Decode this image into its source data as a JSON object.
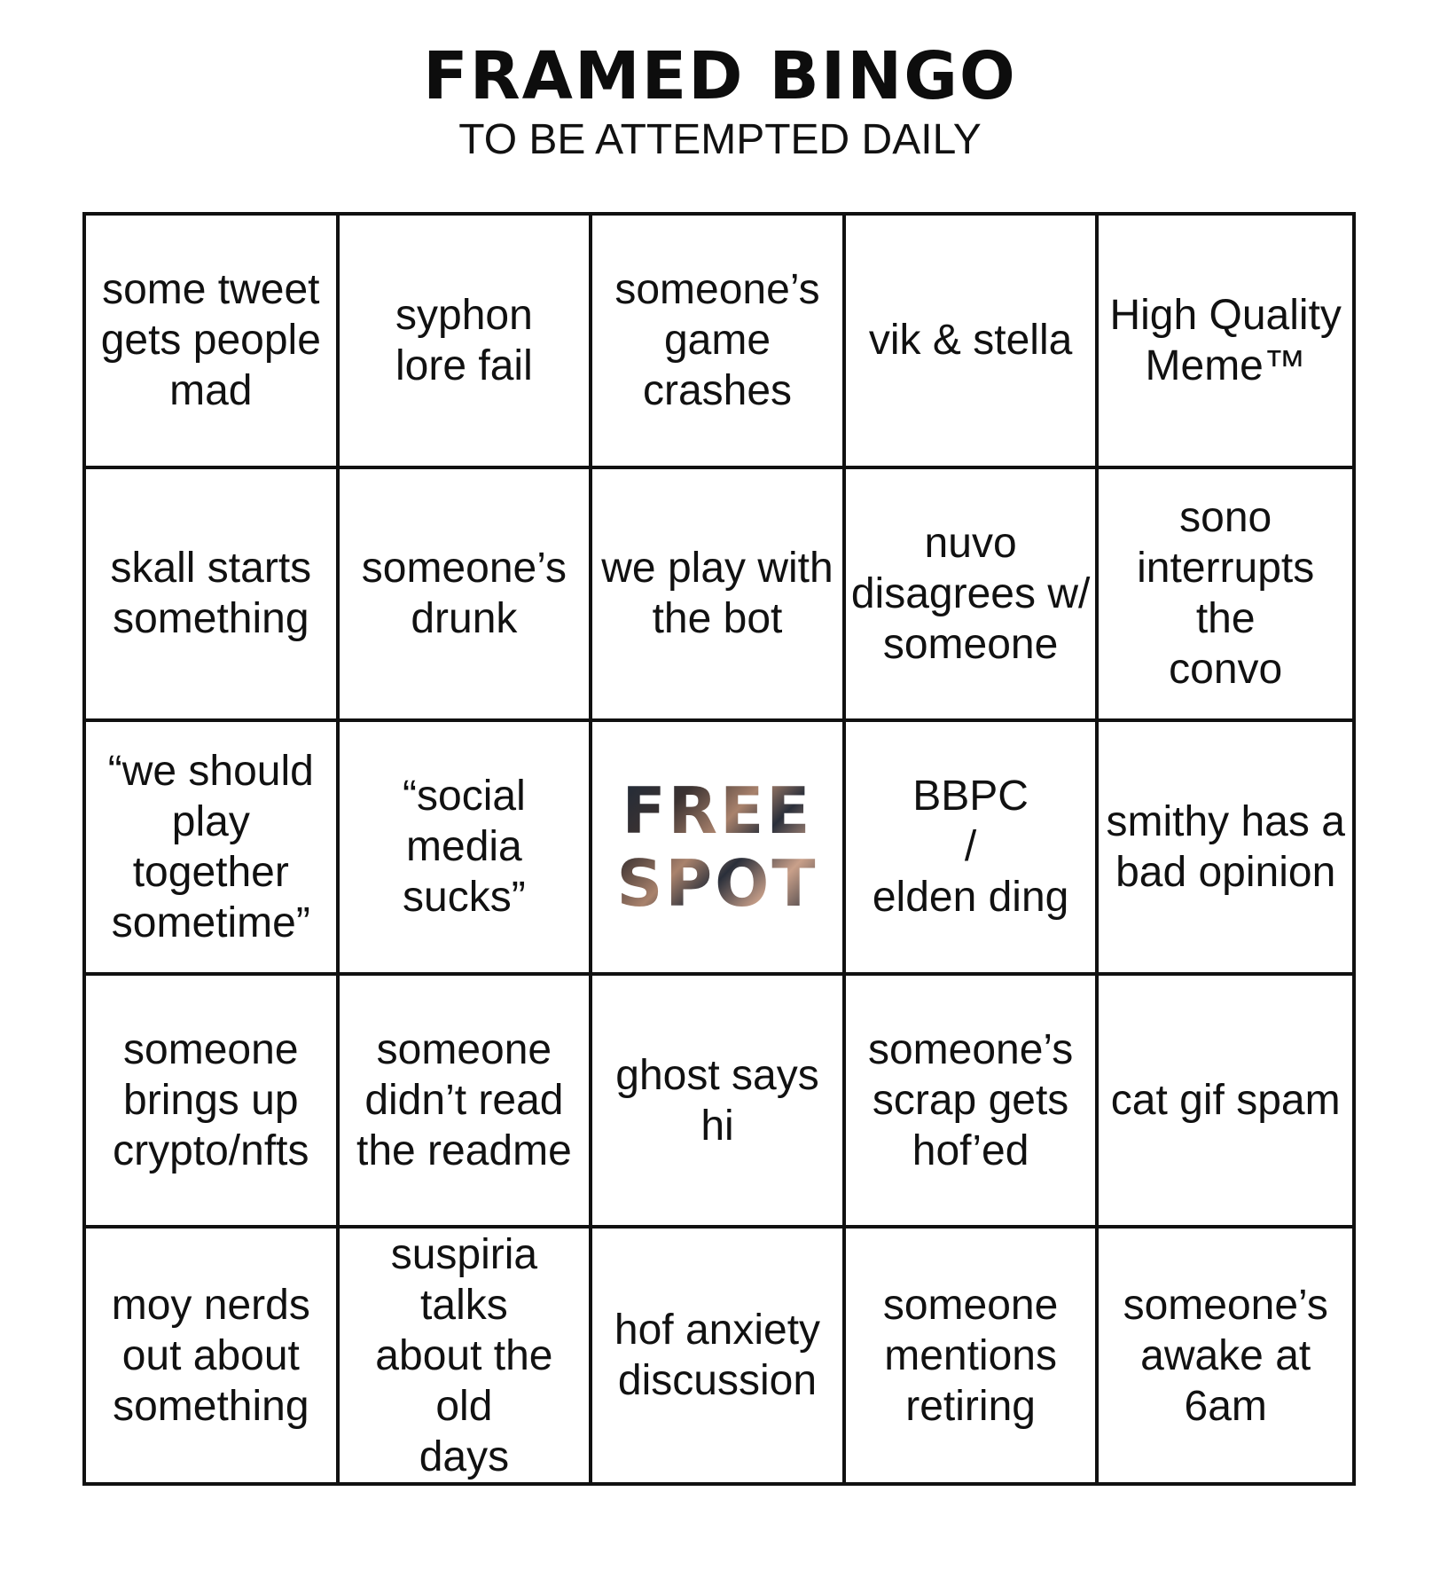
{
  "header": {
    "title": "FRAMED BINGO",
    "subtitle": "TO BE ATTEMPTED DAILY"
  },
  "board": {
    "cells": [
      [
        "some tweet\ngets people\nmad",
        "syphon\nlore fail",
        "someone’s\ngame\ncrashes",
        "vik & stella",
        "High Quality\nMeme™"
      ],
      [
        "skall starts\nsomething",
        "someone’s\ndrunk",
        "we play with\nthe bot",
        "nuvo\ndisagrees w/\nsomeone",
        "sono\ninterrupts the\nconvo"
      ],
      [
        "“we should\nplay together\nsometime”",
        "“social\nmedia\nsucks”",
        "FREE\nSPOT",
        "BBPC\n/\nelden ding",
        "smithy has a\nbad opinion"
      ],
      [
        "someone\nbrings up\ncrypto/nfts",
        "someone\ndidn’t read\nthe readme",
        "ghost says hi",
        "someone’s\nscrap gets\nhof’ed",
        "cat gif spam"
      ],
      [
        "moy nerds\nout about\nsomething",
        "suspiria talks\nabout the old\ndays",
        "hof anxiety\ndiscussion",
        "someone\nmentions\nretiring",
        "someone’s\nawake at\n6am"
      ]
    ]
  }
}
